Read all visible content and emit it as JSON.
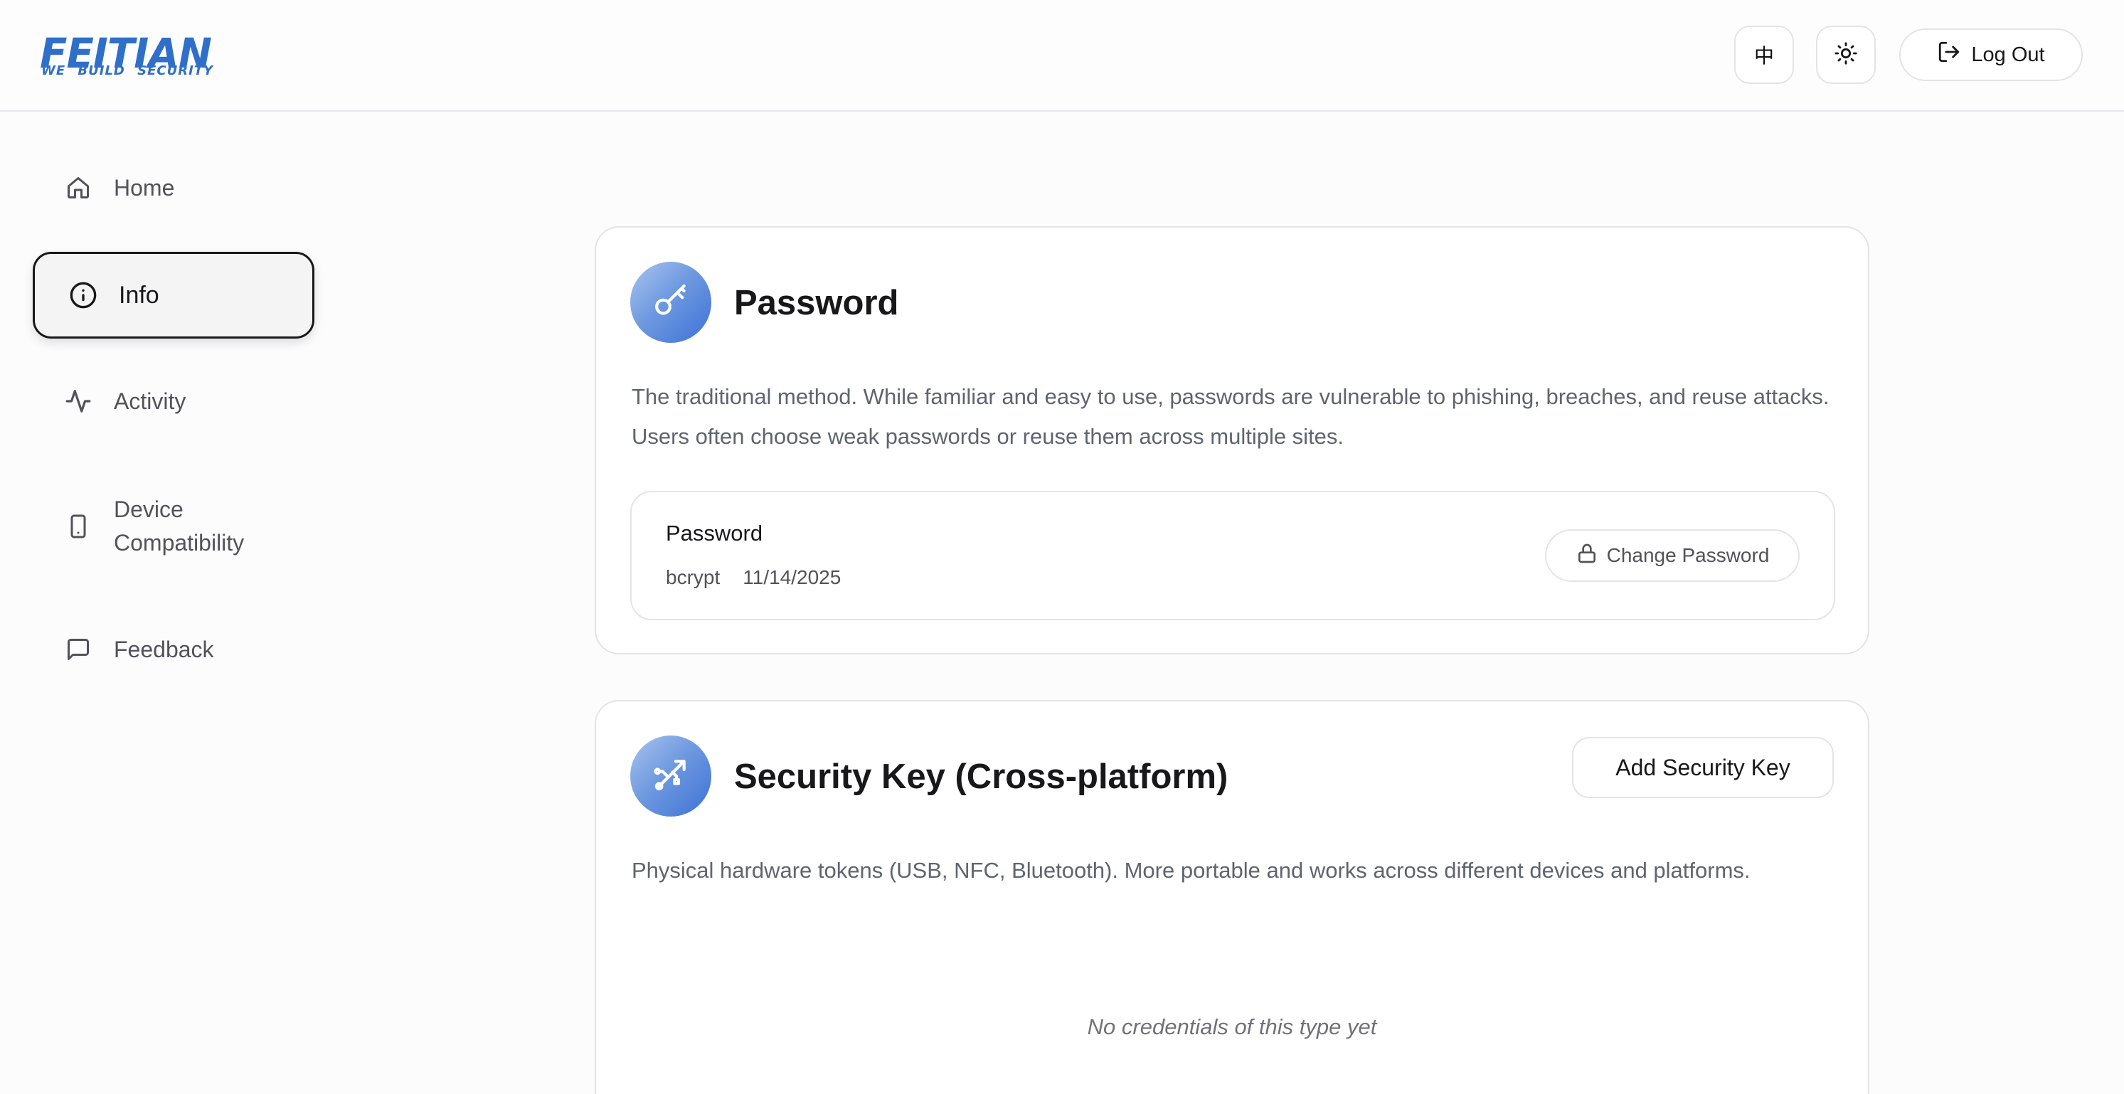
{
  "header": {
    "logo_main": "FEITIAN",
    "logo_sub": "WE BUILD SECURITY",
    "lang_label": "中",
    "logout_label": "Log Out"
  },
  "sidebar": {
    "items": [
      {
        "label": "Home",
        "icon": "home-icon"
      },
      {
        "label": "Info",
        "icon": "info-icon",
        "active": true
      },
      {
        "label": "Activity",
        "icon": "activity-icon"
      },
      {
        "label": "Device Compatibility",
        "line1": "Device",
        "line2": "Compatibility",
        "icon": "smartphone-icon"
      },
      {
        "label": "Feedback",
        "icon": "message-square-icon"
      }
    ]
  },
  "main": {
    "password_card": {
      "title": "Password",
      "description": "The traditional method. While familiar and easy to use, passwords are vulnerable to phishing, breaches, and reuse attacks. Users often choose weak passwords or reuse them across multiple sites.",
      "credential": {
        "name": "Password",
        "algorithm": "bcrypt",
        "date": "11/14/2025"
      },
      "change_label": "Change Password"
    },
    "security_key_card": {
      "title": "Security Key (Cross-platform)",
      "description": "Physical hardware tokens (USB, NFC, Bluetooth). More portable and works across different devices and platforms.",
      "add_label": "Add Security Key",
      "empty_text": "No credentials of this type yet"
    }
  },
  "colors": {
    "brand": "#2f6fc9",
    "badge_gradient_start": "#a9c4ee",
    "badge_gradient_end": "#3d70d6",
    "active_border": "#18181b"
  }
}
